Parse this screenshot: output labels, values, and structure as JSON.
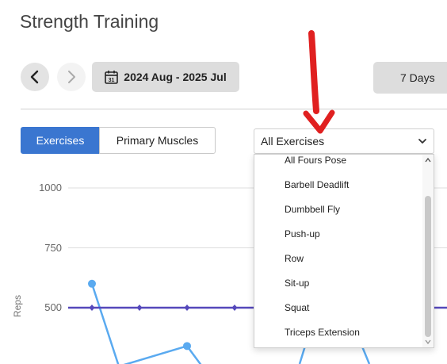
{
  "page": {
    "title": "Strength Training"
  },
  "toolbar": {
    "date_range": "2024 Aug - 2025 Jul",
    "calendar_day": "31",
    "days_label": "7 Days"
  },
  "tabs": {
    "exercises": "Exercises",
    "primary_muscles": "Primary Muscles"
  },
  "select": {
    "selected": "All Exercises"
  },
  "dropdown": {
    "items": [
      "All Fours Pose",
      "Barbell Deadlift",
      "Dumbbell Fly",
      "Push-up",
      "Row",
      "Sit-up",
      "Squat",
      "Triceps Extension"
    ]
  },
  "colors": {
    "accent": "#3a76d0",
    "series_blue": "#5aaaf0",
    "series_purple": "#5548bb",
    "annotation_red": "#e02020"
  },
  "chart_data": {
    "type": "line",
    "ylabel": "Reps",
    "yticks": [
      "1000",
      "750",
      "500"
    ],
    "ylim": [
      0,
      1000
    ],
    "series": [
      {
        "values": [
          600,
          0,
          340,
          0
        ]
      },
      {
        "values": [
          500,
          500,
          500,
          500
        ]
      }
    ]
  }
}
